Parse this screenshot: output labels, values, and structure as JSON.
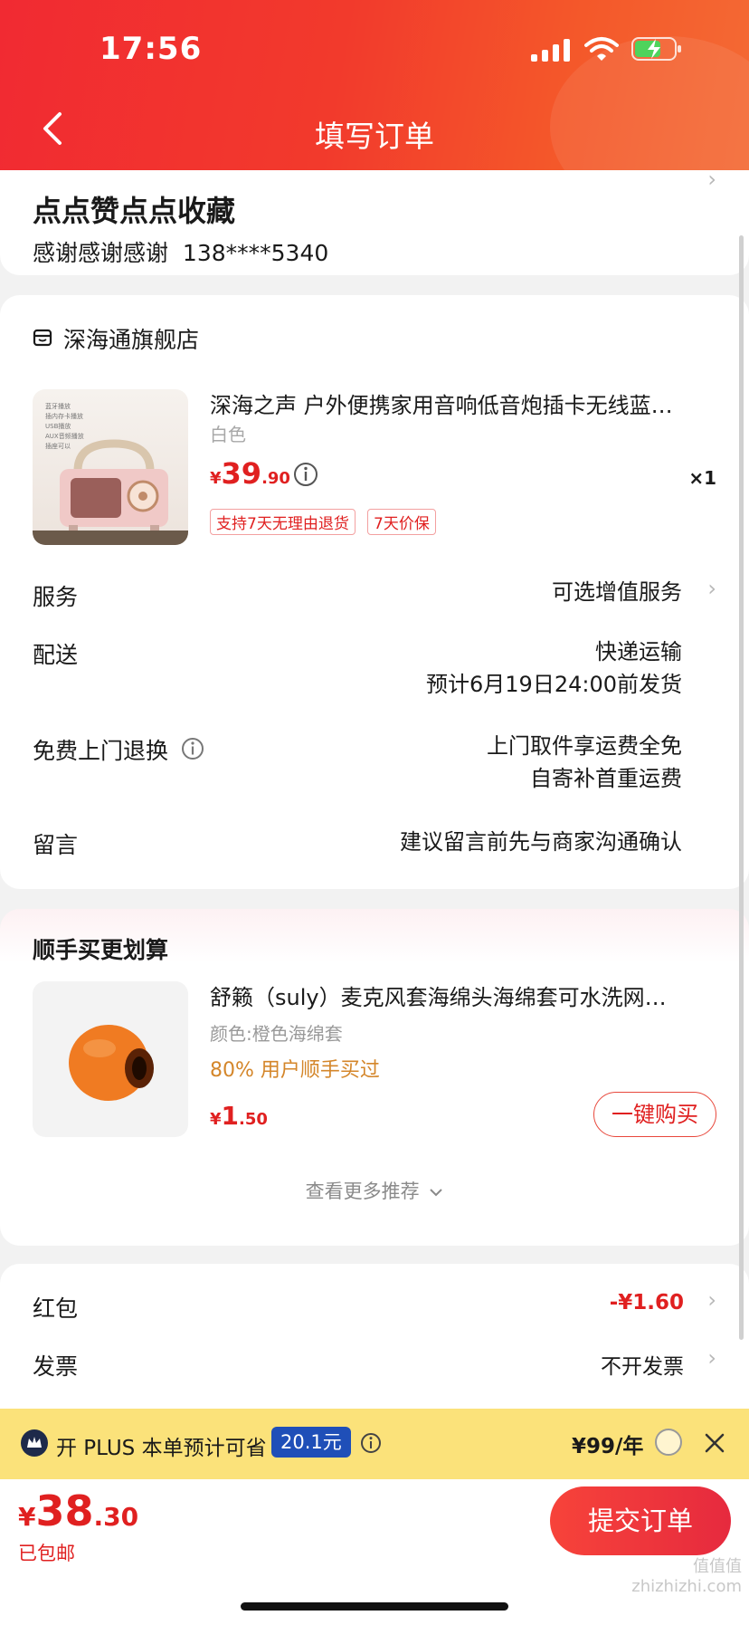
{
  "status_bar": {
    "time": "17:56"
  },
  "header": {
    "title": "填写订单"
  },
  "address": {
    "name": "点点赞点点收藏",
    "contact": "感谢感谢感谢",
    "phone": "138****5340"
  },
  "store": {
    "name": "深海通旗舰店"
  },
  "product": {
    "title": "深海之声 户外便携家用音响低音炮插卡无线蓝…",
    "variant": "白色",
    "price_symbol": "¥",
    "price_int": "39",
    "price_dec": ".90",
    "quantity": "×1",
    "tags": [
      "支持7天无理由退货",
      "7天价保"
    ],
    "thumb_lines": [
      "蓝牙播放",
      "插内存卡播放",
      "USB播放",
      "AUX音频播放",
      "插座可以"
    ]
  },
  "rows": {
    "service_label": "服务",
    "service_value": "可选增值服务",
    "delivery_label": "配送",
    "delivery_line1": "快递运输",
    "delivery_line2": "预计6月19日24:00前发货",
    "return_label": "免费上门退换",
    "return_line1": "上门取件享运费全免",
    "return_line2": "自寄补首重运费",
    "message_label": "留言",
    "message_placeholder": "建议留言前先与商家沟通确认"
  },
  "addon": {
    "title": "顺手买更划算",
    "product_title": "舒籁（suly）麦克风套海绵头海绵套可水洗网…",
    "variant": "颜色:橙色海绵套",
    "social": "80% 用户顺手买过",
    "price_symbol": "¥",
    "price_int": "1",
    "price_dec": ".50",
    "buy_button": "一键购买",
    "more": "查看更多推荐"
  },
  "red_packet": {
    "label": "红包",
    "value": "-¥1.60"
  },
  "invoice": {
    "label": "发票",
    "value": "不开发票"
  },
  "plus_bar": {
    "text": "开 PLUS 本单预计可省",
    "badge": "20.1元",
    "price": "¥99/年"
  },
  "bottom": {
    "price_symbol": "¥",
    "price_int": "38",
    "price_dec": ".30",
    "shipping": "已包邮",
    "submit": "提交订单"
  },
  "watermark": "值值值 zhizhizhi.com",
  "colors": {
    "brand_red": "#e02020",
    "header_gradient_start": "#f12a32",
    "plus_yellow": "#fbe27a",
    "plus_badge": "#1f4fb8",
    "social_orange": "#d4862a"
  }
}
